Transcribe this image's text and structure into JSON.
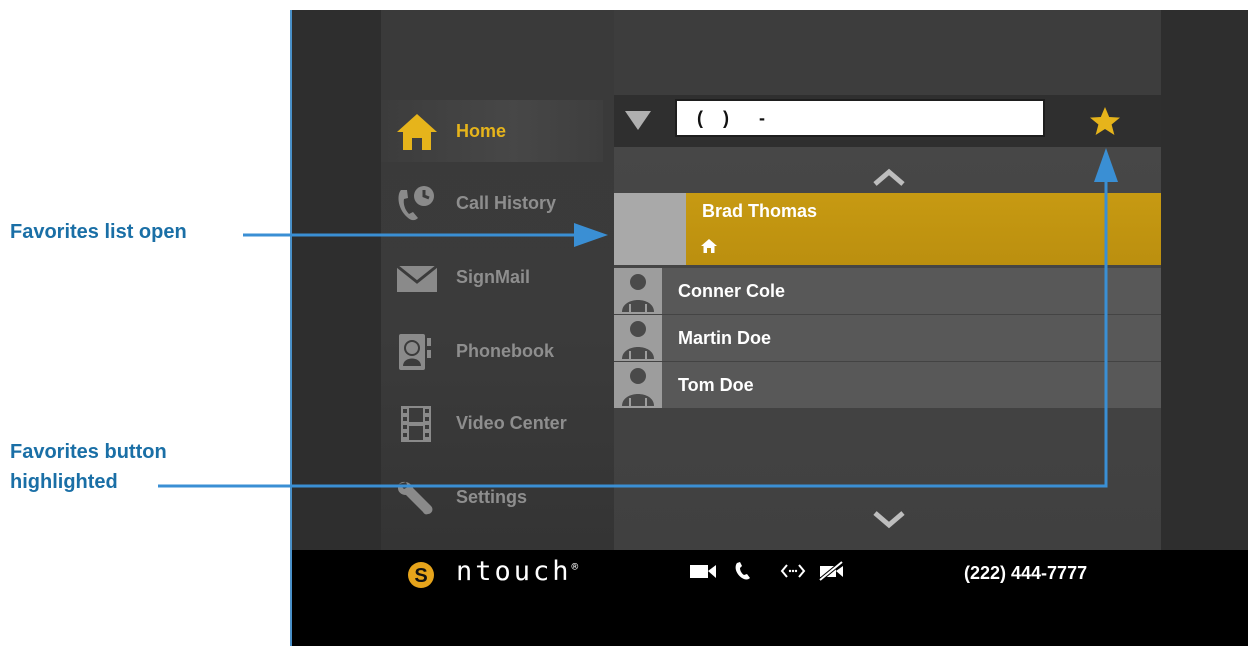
{
  "annotations": {
    "favorites_list": "Favorites list open",
    "favorites_button_line1": "Favorites button",
    "favorites_button_line2": "highlighted"
  },
  "sidebar": {
    "items": [
      {
        "label": "Home",
        "icon": "home-icon",
        "active": true
      },
      {
        "label": "Call History",
        "icon": "call-history-icon"
      },
      {
        "label": "SignMail",
        "icon": "envelope-icon"
      },
      {
        "label": "Phonebook",
        "icon": "phonebook-icon"
      },
      {
        "label": "Video Center",
        "icon": "film-icon"
      },
      {
        "label": "Settings",
        "icon": "wrench-icon"
      }
    ]
  },
  "dial": {
    "value": "(    )      -",
    "favorites_icon": "star-icon"
  },
  "favorites": [
    {
      "name": "Brad Thomas",
      "tag_icon": "home-icon",
      "selected": true
    },
    {
      "name": "Conner Cole",
      "avatar": "person-icon"
    },
    {
      "name": "Martin Doe",
      "avatar": "person-icon"
    },
    {
      "name": "Tom Doe",
      "avatar": "person-icon"
    }
  ],
  "statusbar": {
    "brand": "ntouch",
    "brand_mark": "®",
    "phone_number": "(222) 444-7777",
    "icons": [
      "video-camera-icon",
      "phone-icon",
      "connection-icon",
      "video-privacy-icon"
    ]
  },
  "colors": {
    "accent": "#e6b41b",
    "highlight": "#c79a12",
    "annotation": "#1a6fa6"
  }
}
